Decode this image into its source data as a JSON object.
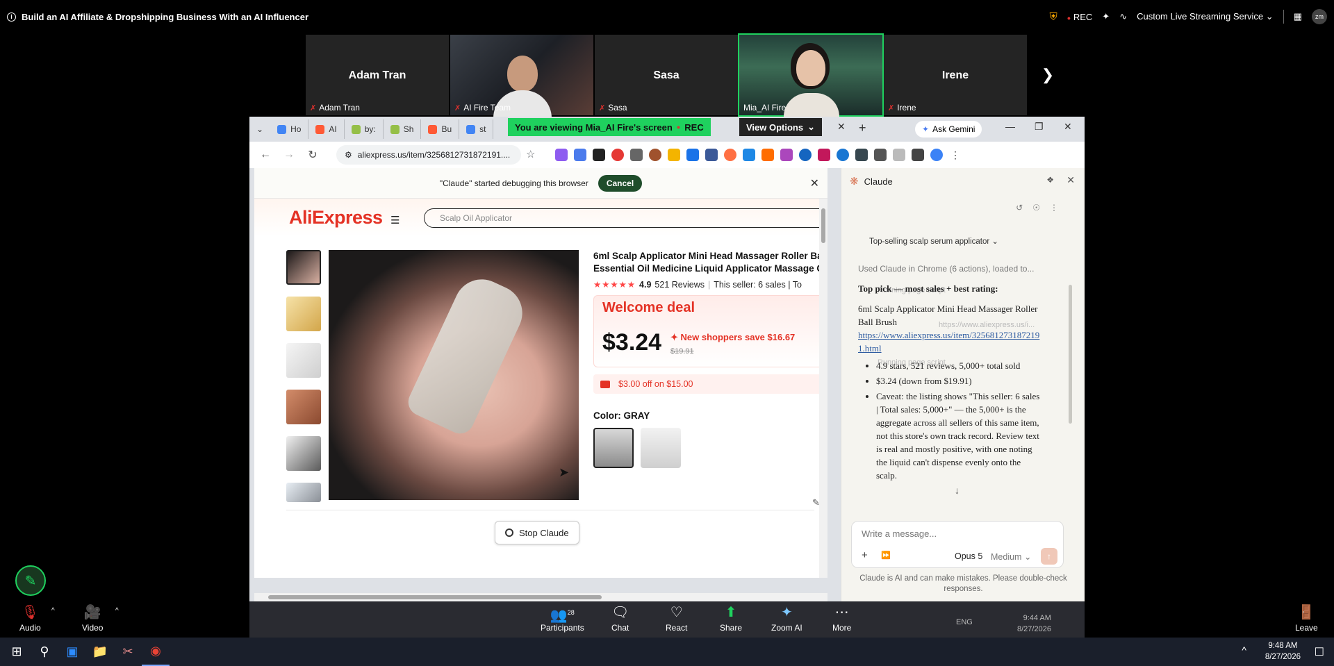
{
  "meeting": {
    "title": "Build an AI Affiliate & Dropshipping Business With an AI Influencer",
    "rec_label": "REC",
    "service_label": "Custom Live Streaming Service",
    "avatar_initials": "zm"
  },
  "participants": [
    {
      "big_name": "Adam Tran",
      "label": "Adam Tran",
      "video": false
    },
    {
      "big_name": "",
      "label": "AI Fire Team",
      "video": true
    },
    {
      "big_name": "Sasa",
      "label": "Sasa",
      "video": false
    },
    {
      "big_name": "",
      "label": "Mia_AI Fire",
      "video": true
    },
    {
      "big_name": "Irene",
      "label": "Irene",
      "video": false
    }
  ],
  "share": {
    "viewing_text": "You are viewing  Mia_AI Fire's screen",
    "rec_label": "REC",
    "view_options_label": "View Options"
  },
  "browser": {
    "tabs": [
      "Ho",
      "AI",
      "by:",
      "Sh",
      "Bu",
      "st"
    ],
    "ask_gemini_label": "Ask Gemini",
    "url": "aliexpress.us/item/3256812731872191....",
    "debug_text": "\"Claude\" started debugging this browser",
    "cancel_label": "Cancel"
  },
  "aliexpress": {
    "logo_main": "AliExpress",
    "search_placeholder": "Scalp Oil Applicator",
    "product_title_1": "6ml Scalp Applicator Mini Head Massager Roller Ba",
    "product_title_2": "Essential Oil Medicine Liquid Applicator Massage C",
    "rating": "4.9",
    "reviews": "521 Reviews",
    "seller": "This seller: 6 sales | To",
    "welcome_deal": "Welcome deal",
    "price": "$3.24",
    "save_text": "New shoppers save $16.67",
    "old_price": "$19.91",
    "coupon_text": "$3.00 off on $15.00",
    "color_label": "Color: GRAY",
    "stop_claude_label": "Stop Claude"
  },
  "claude": {
    "title": "Claude",
    "task_title": "Top-selling scalp serum applicator",
    "used_line": "Used Claude in Chrome (6 actions), loaded to...",
    "top_pick": "Top pick — most sales + best rating:",
    "product_name": "6ml Scalp Applicator Mini Head Massager Roller Ball Brush",
    "link": "https://www.aliexpress.us/item/3256812731872191.html",
    "bullet_1": "4.9 stars, 521 reviews, 5,000+ total sold",
    "bullet_2": "$3.24 (down from $19.91)",
    "bullet_3": "Caveat: the listing shows \"This seller: 6 sales | Total sales: 5,000+\" — the 5,000+ is the aggregate across all sellers of this same item, not this store's own track record. Review text is real and mostly positive, with one noting the liquid can't dispense evenly onto the scalp.",
    "ghost_1": "Running page script",
    "ghost_2": "https://www.aliexpress.us/i...",
    "ghost_3": "Running page script",
    "input_placeholder": "Write a message...",
    "model": "Opus 5",
    "effort": "Medium",
    "disclaimer": "Claude is AI and can make mistakes. Please double-check responses."
  },
  "zoom_controls": {
    "audio": "Audio",
    "video": "Video",
    "participants": "Participants",
    "participants_count": "28",
    "chat": "Chat",
    "react": "React",
    "share": "Share",
    "zoom_ai": "Zoom AI",
    "more": "More",
    "leave": "Leave",
    "inner_time": "9:44 AM",
    "inner_date": "8/27/2026",
    "inner_lang": "ENG"
  },
  "taskbar": {
    "time": "9:48 AM",
    "date": "8/27/2026"
  }
}
